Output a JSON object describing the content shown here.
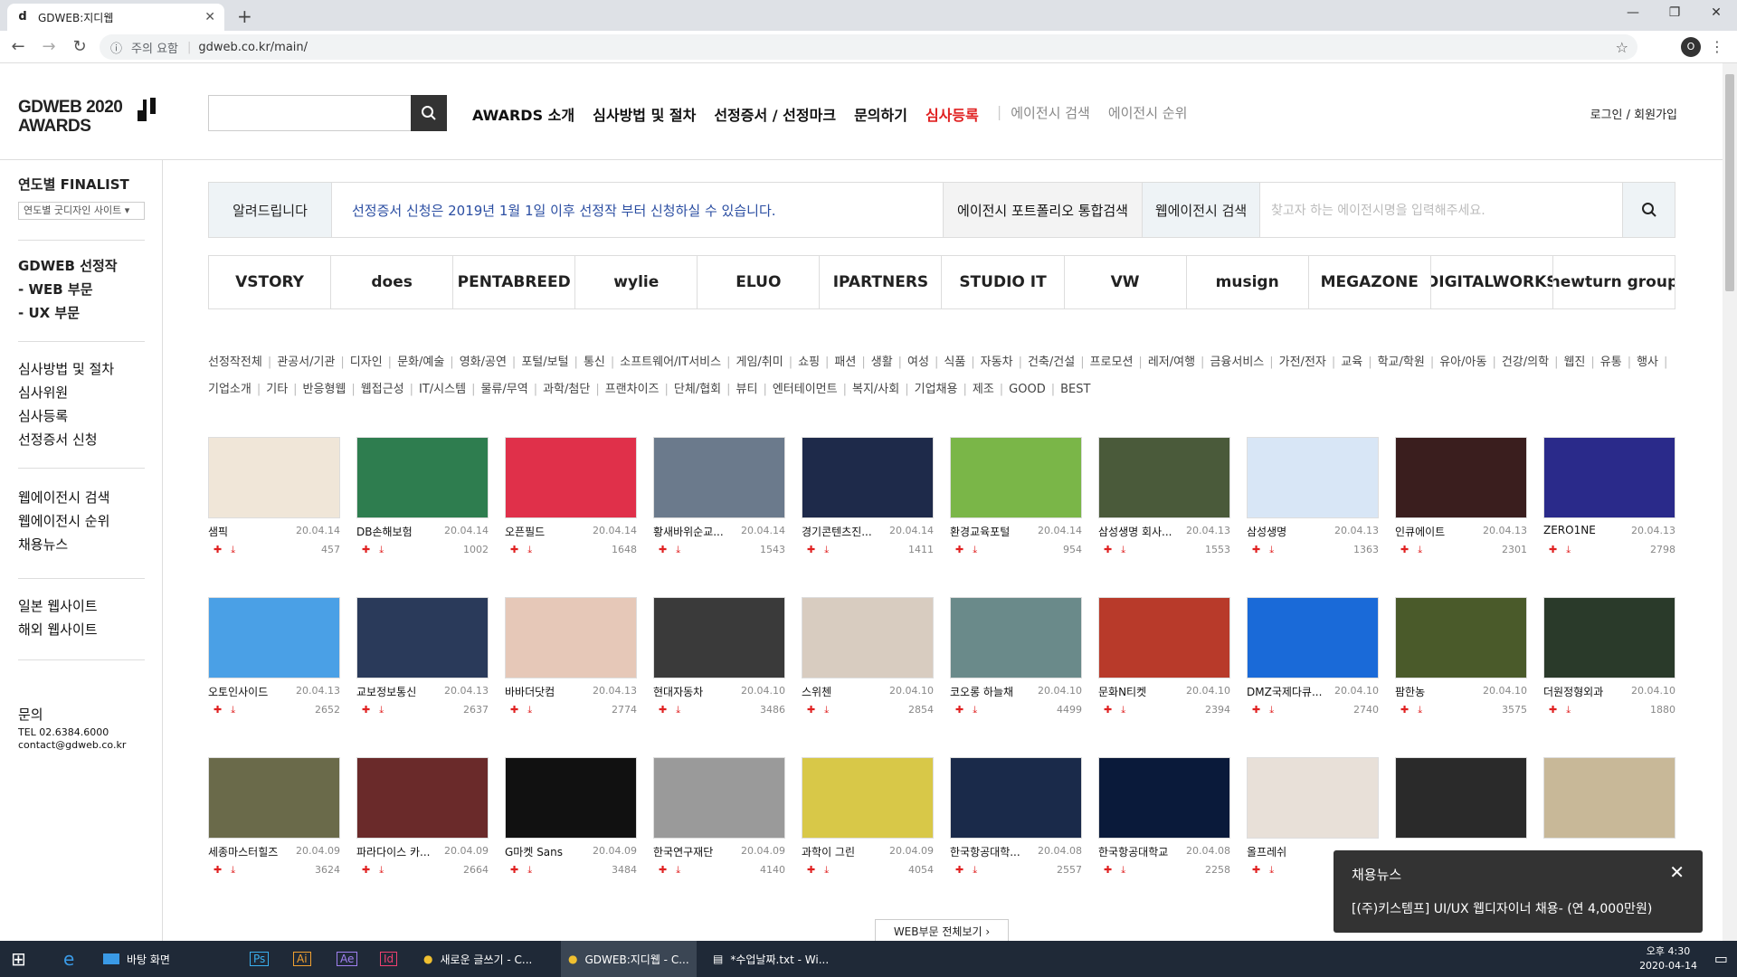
{
  "browser": {
    "tab_title": "GDWEB:지디웹",
    "url_warning": "주의 요함",
    "url": "gdweb.co.kr/main/",
    "profile": "O"
  },
  "site": {
    "logo_line1": "GDWEB 2020",
    "logo_line2": "AWARDS",
    "nav": [
      "AWARDS 소개",
      "심사방법 및 절차",
      "선정증서 / 선정마크",
      "문의하기"
    ],
    "nav_red": "심사등록",
    "nav_thin": [
      "에이전시 검색",
      "에이전시 순위"
    ],
    "login": "로그인 / 회원가입"
  },
  "sidebar": {
    "finalist": "연도별 FINALIST",
    "select": "연도별 굿디자인 사이트",
    "g1": [
      "GDWEB 선정작",
      "- WEB 부문",
      "- UX 부문"
    ],
    "g2": [
      "심사방법 및 절차",
      "심사위원",
      "심사등록",
      "선정증서 신청"
    ],
    "g3": [
      "웹에이전시 검색",
      "웹에이전시 순위",
      "채용뉴스"
    ],
    "g4": [
      "일본 웹사이트",
      "해외 웹사이트"
    ],
    "contact_title": "문의",
    "tel": "TEL 02.6384.6000",
    "email": "contact@gdweb.co.kr"
  },
  "notice": {
    "label": "알려드립니다",
    "msg": "선정증서 신청은 2019년 1월 1일 이후 선정작 부터 신청하실 수 있습니다.",
    "portfolio": "에이전시 포트폴리오 통합검색",
    "web_agency": "웹에이전시 검색",
    "placeholder": "찾고자 하는 에이전시명을 입력해주세요."
  },
  "agency_logos": [
    "VSTORY",
    "does",
    "PENTABREED",
    "wylie",
    "ELUO",
    "IPARTNERS",
    "STUDIO IT",
    "VW",
    "musign",
    "MEGAZONE",
    "DIGITALWORKS",
    "newturn group"
  ],
  "categories": [
    "선정작전체",
    "관공서/기관",
    "디자인",
    "문화/예술",
    "영화/공연",
    "포털/보털",
    "통신",
    "소프트웨어/IT서비스",
    "게임/취미",
    "쇼핑",
    "패션",
    "생활",
    "여성",
    "식품",
    "자동차",
    "건축/건설",
    "프로모션",
    "레저/여행",
    "금융서비스",
    "가전/전자",
    "교육",
    "학교/학원",
    "유아/아동",
    "건강/의학",
    "웹진",
    "유통",
    "행사",
    "기업소개",
    "기타",
    "반응형웹",
    "웹접근성",
    "IT/시스템",
    "물류/무역",
    "과학/첨단",
    "프랜차이즈",
    "단체/협회",
    "뷰티",
    "엔터테이먼트",
    "복지/사회",
    "기업채용",
    "제조",
    "GOOD",
    "BEST"
  ],
  "items": [
    {
      "name": "샘픽",
      "date": "20.04.14",
      "count": "457",
      "color": "#f0e6d8"
    },
    {
      "name": "DB손해보험",
      "date": "20.04.14",
      "count": "1002",
      "color": "#2e7d4f"
    },
    {
      "name": "오픈필드",
      "date": "20.04.14",
      "count": "1648",
      "color": "#e0304a"
    },
    {
      "name": "황새바위순교...",
      "date": "20.04.14",
      "count": "1543",
      "color": "#6b7a8c"
    },
    {
      "name": "경기콘텐츠진...",
      "date": "20.04.14",
      "count": "1411",
      "color": "#1e2a4a"
    },
    {
      "name": "환경교육포털",
      "date": "20.04.14",
      "count": "954",
      "color": "#7ab648"
    },
    {
      "name": "삼성생명 회사...",
      "date": "20.04.13",
      "count": "1553",
      "color": "#4a5a3a"
    },
    {
      "name": "삼성생명",
      "date": "20.04.13",
      "count": "1363",
      "color": "#d8e6f6"
    },
    {
      "name": "인큐에이트",
      "date": "20.04.13",
      "count": "2301",
      "color": "#3a1e1e"
    },
    {
      "name": "ZERO1NE",
      "date": "20.04.13",
      "count": "2798",
      "color": "#2a2a8a"
    },
    {
      "name": "오토인사이드",
      "date": "20.04.13",
      "count": "2652",
      "color": "#4aa0e6"
    },
    {
      "name": "교보정보통신",
      "date": "20.04.13",
      "count": "2637",
      "color": "#2a3a5a"
    },
    {
      "name": "바바더닷컴",
      "date": "20.04.13",
      "count": "2774",
      "color": "#e6c8b8"
    },
    {
      "name": "현대자동차",
      "date": "20.04.10",
      "count": "3486",
      "color": "#3a3a3a"
    },
    {
      "name": "스위첸",
      "date": "20.04.10",
      "count": "2854",
      "color": "#d8ccc0"
    },
    {
      "name": "코오롱 하늘채",
      "date": "20.04.10",
      "count": "4499",
      "color": "#6a8a8a"
    },
    {
      "name": "문화N티켓",
      "date": "20.04.10",
      "count": "2394",
      "color": "#b83a2a"
    },
    {
      "name": "DMZ국제다큐...",
      "date": "20.04.10",
      "count": "2740",
      "color": "#1a6ad8"
    },
    {
      "name": "팜한농",
      "date": "20.04.10",
      "count": "3575",
      "color": "#4a5a2a"
    },
    {
      "name": "더원정형외과",
      "date": "20.04.10",
      "count": "1880",
      "color": "#2a3a2a"
    },
    {
      "name": "세종마스터힐즈",
      "date": "20.04.09",
      "count": "3624",
      "color": "#6a6a4a"
    },
    {
      "name": "파라다이스 카...",
      "date": "20.04.09",
      "count": "2664",
      "color": "#6a2a2a"
    },
    {
      "name": "G마켓 Sans",
      "date": "20.04.09",
      "count": "3484",
      "color": "#111111"
    },
    {
      "name": "한국연구재단",
      "date": "20.04.09",
      "count": "4140",
      "color": "#9a9a9a"
    },
    {
      "name": "과학이 그린",
      "date": "20.04.09",
      "count": "4054",
      "color": "#d8c848"
    },
    {
      "name": "한국항공대학...",
      "date": "20.04.08",
      "count": "2557",
      "color": "#1a2a4a"
    },
    {
      "name": "한국항공대학교",
      "date": "20.04.08",
      "count": "2258",
      "color": "#0a1a3a"
    },
    {
      "name": "올프레쉬",
      "date": "",
      "count": "",
      "color": "#e8e0d8"
    },
    {
      "name": "",
      "date": "",
      "count": "",
      "color": "#2a2a2a"
    },
    {
      "name": "",
      "date": "",
      "count": "",
      "color": "#c8b898"
    }
  ],
  "more_btn": "WEB부문 전체보기  ›",
  "toast": {
    "title": "채용뉴스",
    "body": "[(주)키스템프] UI/UX 웹디자이너 채용- (연 4,000만원)"
  },
  "taskbar": {
    "desktop": "바탕 화면",
    "t1": "새로운 글쓰기 - C...",
    "t2": "GDWEB:지디웹 - C...",
    "t3": "*수업날짜.txt - Wi...",
    "time": "오후 4:30",
    "date": "2020-04-14"
  }
}
